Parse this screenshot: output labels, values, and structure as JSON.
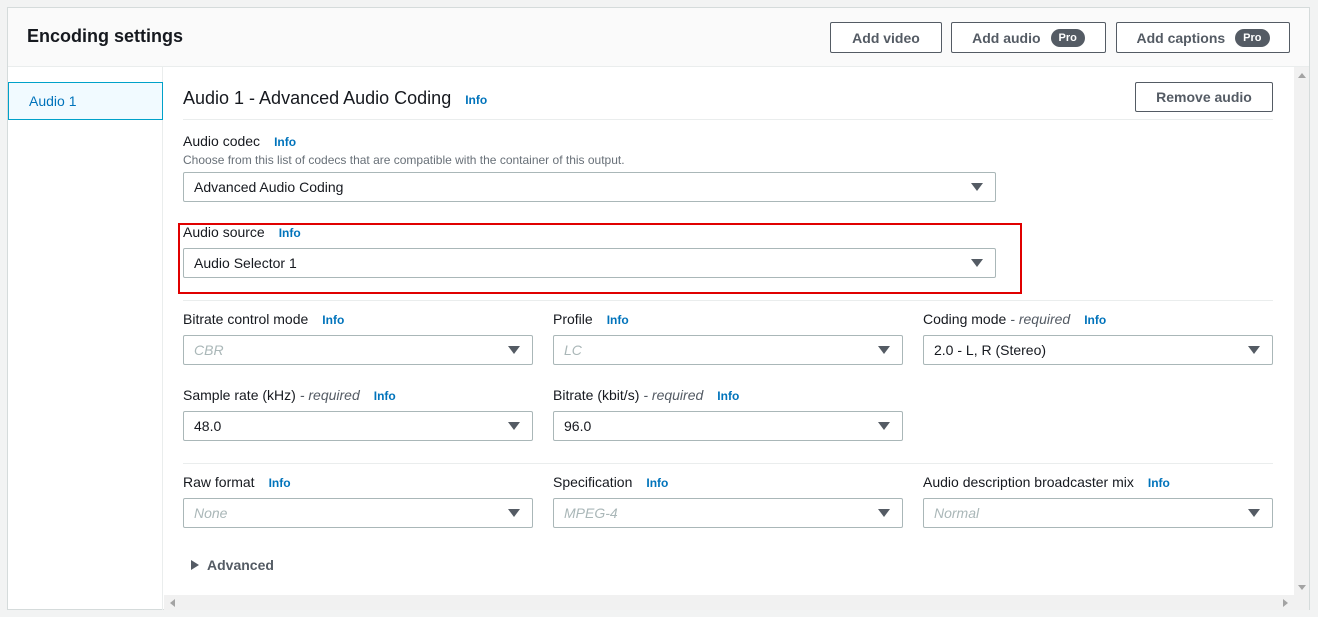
{
  "header": {
    "title": "Encoding settings",
    "add_video": "Add video",
    "add_audio": "Add audio",
    "add_captions": "Add captions",
    "pro_badge": "Pro"
  },
  "sidebar": {
    "items": [
      {
        "label": "Audio 1",
        "selected": true
      }
    ]
  },
  "section": {
    "title": "Audio 1 - Advanced Audio Coding",
    "info": "Info",
    "remove_button": "Remove audio"
  },
  "fields": {
    "audio_codec": {
      "label": "Audio codec",
      "info": "Info",
      "description": "Choose from this list of codecs that are compatible with the container of this output.",
      "value": "Advanced Audio Coding"
    },
    "audio_source": {
      "label": "Audio source",
      "info": "Info",
      "value": "Audio Selector 1"
    },
    "bitrate_control_mode": {
      "label": "Bitrate control mode",
      "info": "Info",
      "value": "CBR",
      "disabled": true
    },
    "profile": {
      "label": "Profile",
      "info": "Info",
      "value": "LC",
      "disabled": true
    },
    "coding_mode": {
      "label": "Coding mode",
      "required": "- required",
      "info": "Info",
      "value": "2.0 - L, R (Stereo)"
    },
    "sample_rate": {
      "label": "Sample rate (kHz)",
      "required": "- required",
      "info": "Info",
      "value": "48.0"
    },
    "bitrate": {
      "label": "Bitrate (kbit/s)",
      "required": "- required",
      "info": "Info",
      "value": "96.0"
    },
    "raw_format": {
      "label": "Raw format",
      "info": "Info",
      "value": "None",
      "disabled": true
    },
    "specification": {
      "label": "Specification",
      "info": "Info",
      "value": "MPEG-4",
      "disabled": true
    },
    "audio_description_mix": {
      "label": "Audio description broadcaster mix",
      "info": "Info",
      "value": "Normal",
      "disabled": true
    }
  },
  "advanced": {
    "label": "Advanced"
  },
  "colors": {
    "accent": "#0073bb",
    "highlight": "#e00000",
    "selected_bg": "#f1faff"
  }
}
